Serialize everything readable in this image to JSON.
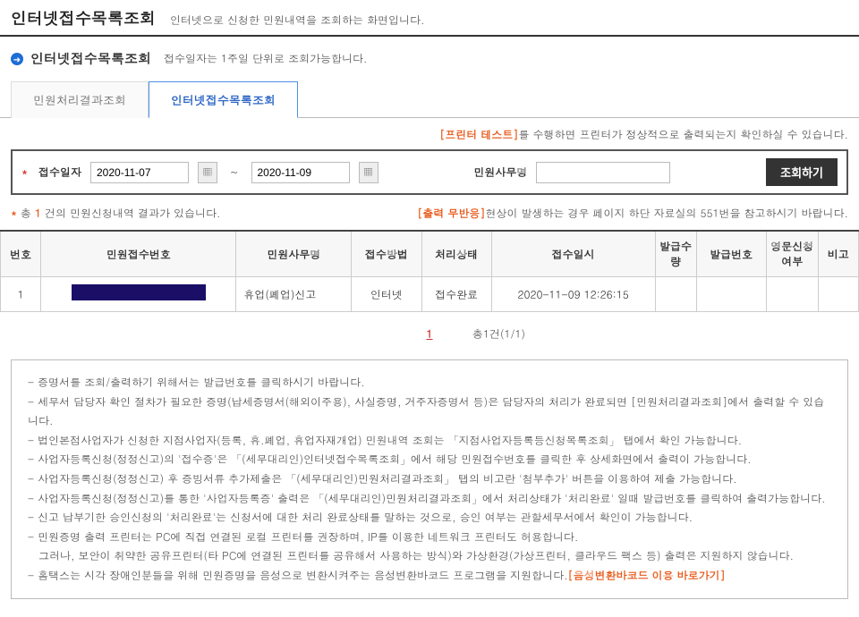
{
  "page": {
    "title": "인터넷접수목록조회",
    "desc": "인터넷으로 신청한 민원내역을 조회하는 화면입니다."
  },
  "section": {
    "title": "인터넷접수목록조회",
    "desc": "접수일자는 1주일 단위로 조회가능합니다."
  },
  "tabs": {
    "t1": "민원처리결과조회",
    "t2": "인터넷접수목록조회"
  },
  "printer_test": {
    "label": "[프린터 테스트]",
    "after": "를 수행하면 프린터가 정상적으로 출력되는지 확인하실 수 있습니다."
  },
  "search": {
    "date_label": "접수일자",
    "date_from": "2020-11-07",
    "date_to": "2020-11-09",
    "name_label": "민원사무명",
    "name_value": "",
    "button": "조회하기"
  },
  "result_count": {
    "prefix_bullet": "*",
    "prefix": " 총 ",
    "count": "1",
    "suffix": " 건의 민원신청내역 결과가 있습니다.",
    "warn_label": "[출력 무반응]",
    "warn_after": "현상이 발생하는 경우 페이지 하단 자료실의 551번을 참고하시기 바랍니다."
  },
  "table": {
    "headers": {
      "no": "번호",
      "recno": "민원접수번호",
      "name": "민원사무명",
      "method": "접수방법",
      "status": "처리상태",
      "date": "접수일시",
      "qty": "발급수량",
      "issueno": "발급번호",
      "eng": "영문신청여부",
      "remark": "비고"
    },
    "row": {
      "no": "1",
      "name": "휴업(폐업)신고",
      "method": "인터넷",
      "status": "접수완료",
      "date": "2020-11-09 12:26:15",
      "qty": "",
      "issueno": "",
      "eng": "",
      "remark": ""
    }
  },
  "pager": {
    "current": "1",
    "total": "총1건(1/1)"
  },
  "help": {
    "l1": "- 증명서를 조회/출력하기 위해서는 발급번호를 클릭하시기 바랍니다.",
    "l2": "- 세무서 담당자 확인 절차가 필요한 증명(납세증명서(해외이주용), 사실증명, 거주자증명서 등)은 담당자의 처리가 완료되면 [민원처리결과조회]에서 출력할 수 있습니다.",
    "l3": "- 법인본점사업자가 신청한 지점사업자(등록, 휴.폐업, 휴업자재개업) 민원내역 조회는 「지점사업자등록등신청목록조회」 탭에서 확인 가능합니다.",
    "l4": "- 사업자등록신청(정정신고)의 '접수증'은  「(세무대리인)인터넷접수목록조회」에서 해당 민원접수번호를 클릭한 후 상세화면에서 출력이 가능합니다.",
    "l5": "- 사업자등록신청(정정신고) 후 증빙서류 추가제출은  「(세무대리인)민원처리결과조회」 탭의 비고란 '첨부추가' 버튼을 이용하여 제출 가능합니다.",
    "l6": "- 사업자등록신청(정정신고)를 통한 '사업자등록증' 출력은    「(세무대리인)민원처리결과조회」에서 처리상태가 '처리완료' 일때 발급번호를 클릭하여 출력가능합니다.",
    "l7": "- 신고 납부기한 승인신청의 '처리완료'는 신청서에 대한 처리 완료상태를 말하는 것으로, 승인 여부는 관할세무서에서 확인이 가능합니다.",
    "l8": "- 민원증명 출력 프린터는 PC에 직접 연결된 로컬 프린터를 권장하며, IP를 이용한 네트워크 프린터도 허용합니다.",
    "l8b": "그러나, 보안이 취약한 공유프린터(타 PC에 연결된 프린터를 공유해서 사용하는 방식)와 가상환경(가상프린터, 클라우드 팩스 등) 출력은 지원하지 않습니다.",
    "l9a": "- 홈택스는 시각 장애인분들을 위해 민원증명을 음성으로 변환시켜주는 음성변환바코드 프로그램을 지원합니다.",
    "l9b": "[음성변환바코드 이용 바로가기]"
  }
}
